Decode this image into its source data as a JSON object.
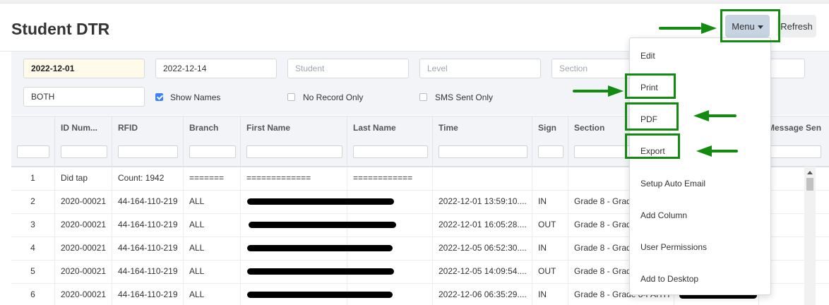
{
  "page": {
    "title": "Student DTR"
  },
  "toolbar": {
    "menu_label": "Menu",
    "refresh_label": "Refresh"
  },
  "filters": {
    "date_from": "2022-12-01",
    "date_to": "2022-12-14",
    "student_placeholder": "Student",
    "level_placeholder": "Level",
    "section_placeholder": "Section",
    "mode": "BOTH",
    "show_names_label": "Show Names",
    "no_record_only_label": "No Record Only",
    "sms_sent_only_label": "SMS Sent Only"
  },
  "grid": {
    "columns": [
      "ID Num...",
      "RFID",
      "Branch",
      "First Name",
      "Last Name",
      "Time",
      "Sign",
      "Section",
      "Message Sen"
    ],
    "rows": [
      {
        "num": "1",
        "id": "Did tap",
        "rfid": "Count: 1942",
        "branch": "=======",
        "first": "=============",
        "last": "============",
        "time": "",
        "sign": "",
        "section": ""
      },
      {
        "num": "2",
        "id": "2020-00021",
        "rfid": "44-164-110-219",
        "branch": "ALL",
        "first": "",
        "last": "",
        "time": "2022-12-01 13:59:10....",
        "sign": "IN",
        "section": "Grade 8 - Grad"
      },
      {
        "num": "3",
        "id": "2020-00021",
        "rfid": "44-164-110-219",
        "branch": "ALL",
        "first": "",
        "last": "",
        "time": "2022-12-01 16:05:28....",
        "sign": "OUT",
        "section": "Grade 8 - Grad"
      },
      {
        "num": "4",
        "id": "2020-00021",
        "rfid": "44-164-110-219",
        "branch": "ALL",
        "first": "",
        "last": "",
        "time": "2022-12-05 06:52:30....",
        "sign": "IN",
        "section": "Grade 8 - Grad"
      },
      {
        "num": "5",
        "id": "2020-00021",
        "rfid": "44-164-110-219",
        "branch": "ALL",
        "first": "",
        "last": "",
        "time": "2022-12-05 14:09:54....",
        "sign": "OUT",
        "section": "Grade 8 - Grad"
      },
      {
        "num": "6",
        "id": "2020-00021",
        "rfid": "44-164-110-219",
        "branch": "ALL",
        "first": "",
        "last": "",
        "time": "2022-12-06 06:35:29....",
        "sign": "IN",
        "section": "Grade 8 - Grade 8-FAITH"
      }
    ]
  },
  "menu": {
    "items": [
      "Edit",
      "Print",
      "PDF",
      "Export",
      "Setup Auto Email",
      "Add Column",
      "User Permissions",
      "Add to Desktop"
    ]
  },
  "colors": {
    "annotation": "#138a10",
    "menu_button": "#c7d4e2",
    "checkbox_on": "#3b82f6"
  }
}
